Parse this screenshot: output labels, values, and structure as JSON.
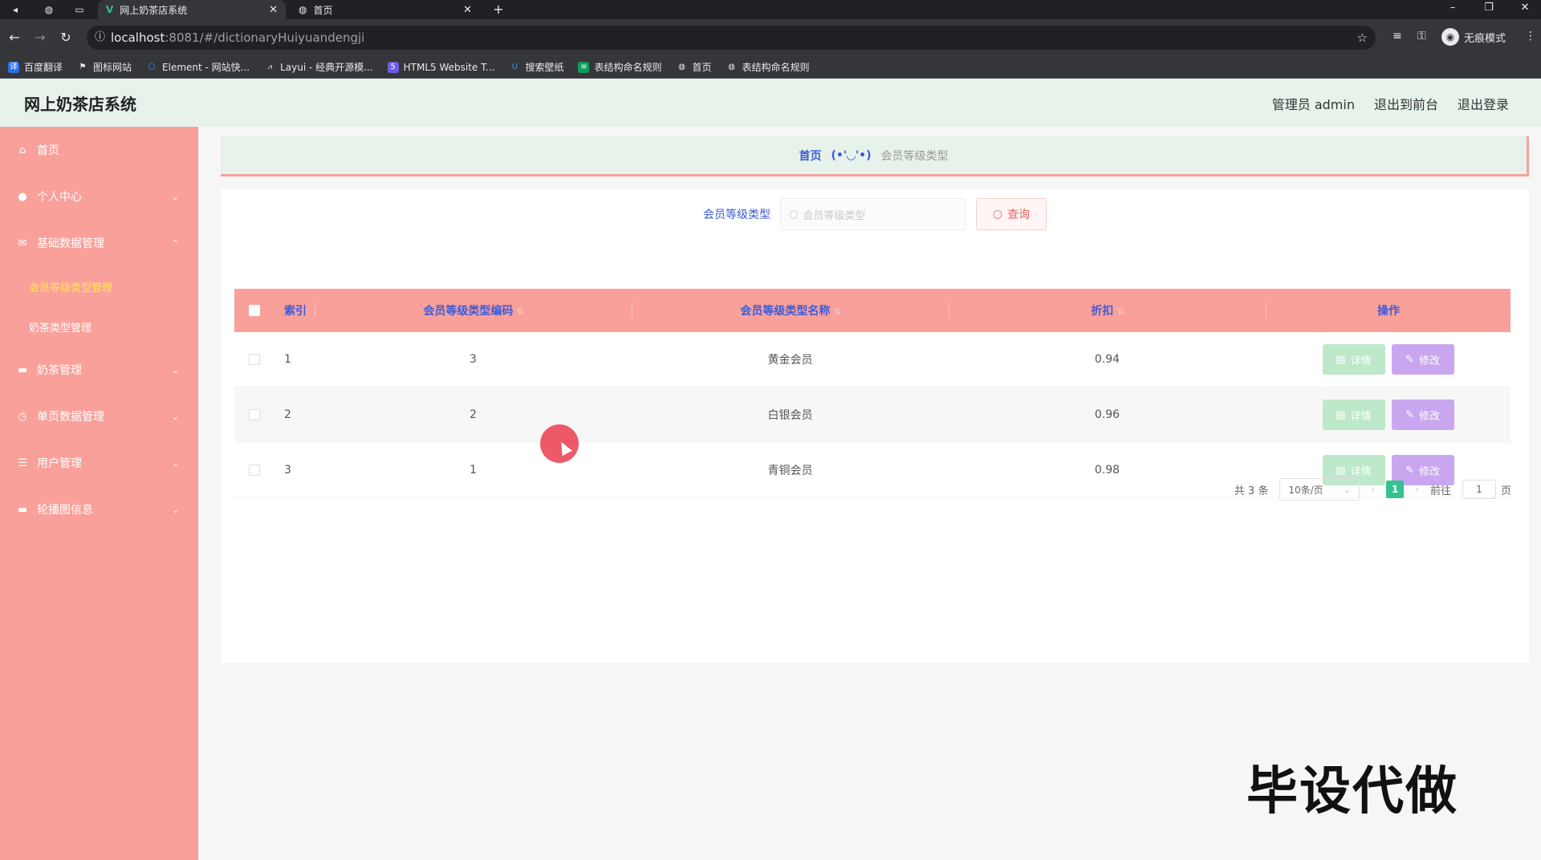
{
  "browser": {
    "tabs": [
      {
        "title": "网上奶茶店系统",
        "icon": "vue-icon",
        "active": true
      },
      {
        "title": "首页",
        "icon": "globe-icon",
        "active": false
      }
    ],
    "url_host": "localhost",
    "url_path": ":8081/#/dictionaryHuiyuandengji",
    "incognito_label": "无痕模式",
    "bookmarks": [
      {
        "label": "百度翻译",
        "color": "#2b6fe8",
        "icon": "baidu-translate-icon"
      },
      {
        "label": "图标网站",
        "color": "#e8eaed",
        "icon": "flag-icon"
      },
      {
        "label": "Element - 网站快...",
        "color": "#409eff",
        "icon": "element-icon"
      },
      {
        "label": "Layui - 经典开源模...",
        "color": "#e8eaed",
        "icon": "layui-icon"
      },
      {
        "label": "HTML5 Website T...",
        "color": "#6c5ce7",
        "icon": "html5-icon"
      },
      {
        "label": "搜索壁纸",
        "color": "#4a90e2",
        "icon": "wallpaper-icon"
      },
      {
        "label": "表结构命名规则",
        "color": "#0f9d58",
        "icon": "sheet-icon"
      },
      {
        "label": "首页",
        "color": "#e8eaed",
        "icon": "globe-icon"
      },
      {
        "label": "表结构命名规则",
        "color": "#e8eaed",
        "icon": "globe-icon"
      }
    ]
  },
  "header": {
    "title": "网上奶茶店系统",
    "user": "管理员 admin",
    "to_front": "退出到前台",
    "logout": "退出登录"
  },
  "sidebar": {
    "items": [
      {
        "label": "首页",
        "icon": "home-icon",
        "has_children": false
      },
      {
        "label": "个人中心",
        "icon": "person-icon",
        "has_children": true
      },
      {
        "label": "基础数据管理",
        "icon": "mail-icon",
        "has_children": true,
        "expanded": true,
        "children": [
          {
            "label": "会员等级类型管理",
            "active": true
          },
          {
            "label": "奶茶类型管理",
            "active": false
          }
        ]
      },
      {
        "label": "奶茶管理",
        "icon": "monitor-icon",
        "has_children": true
      },
      {
        "label": "单页数据管理",
        "icon": "clock-icon",
        "has_children": true
      },
      {
        "label": "用户管理",
        "icon": "list-icon",
        "has_children": true
      },
      {
        "label": "轮播图信息",
        "icon": "monitor-icon",
        "has_children": true
      }
    ]
  },
  "breadcrumb": {
    "home": "首页",
    "separator": "(•'◡'•)",
    "current": "会员等级类型"
  },
  "search": {
    "label": "会员等级类型",
    "placeholder": "会员等级类型",
    "button": "查询"
  },
  "table": {
    "columns": [
      "索引",
      "会员等级类型编码",
      "会员等级类型名称",
      "折扣",
      "操作"
    ],
    "rows": [
      {
        "index": "1",
        "code": "3",
        "name": "黄金会员",
        "discount": "0.94"
      },
      {
        "index": "2",
        "code": "2",
        "name": "白银会员",
        "discount": "0.96"
      },
      {
        "index": "3",
        "code": "1",
        "name": "青铜会员",
        "discount": "0.98"
      }
    ],
    "detail_label": "详情",
    "edit_label": "修改"
  },
  "pagination": {
    "total": "共 3 条",
    "page_size": "10条/页",
    "current_page": "1",
    "goto_prefix": "前往",
    "goto_value": "1",
    "goto_suffix": "页"
  },
  "watermark": "毕设代做",
  "colors": {
    "sidebar": "#f9a09a",
    "header": "#e6f2ea",
    "accent_text": "#3b5bd8",
    "detail_button": "#bde8c9",
    "edit_button": "#c9a6f0",
    "active_page": "#34c38f"
  }
}
